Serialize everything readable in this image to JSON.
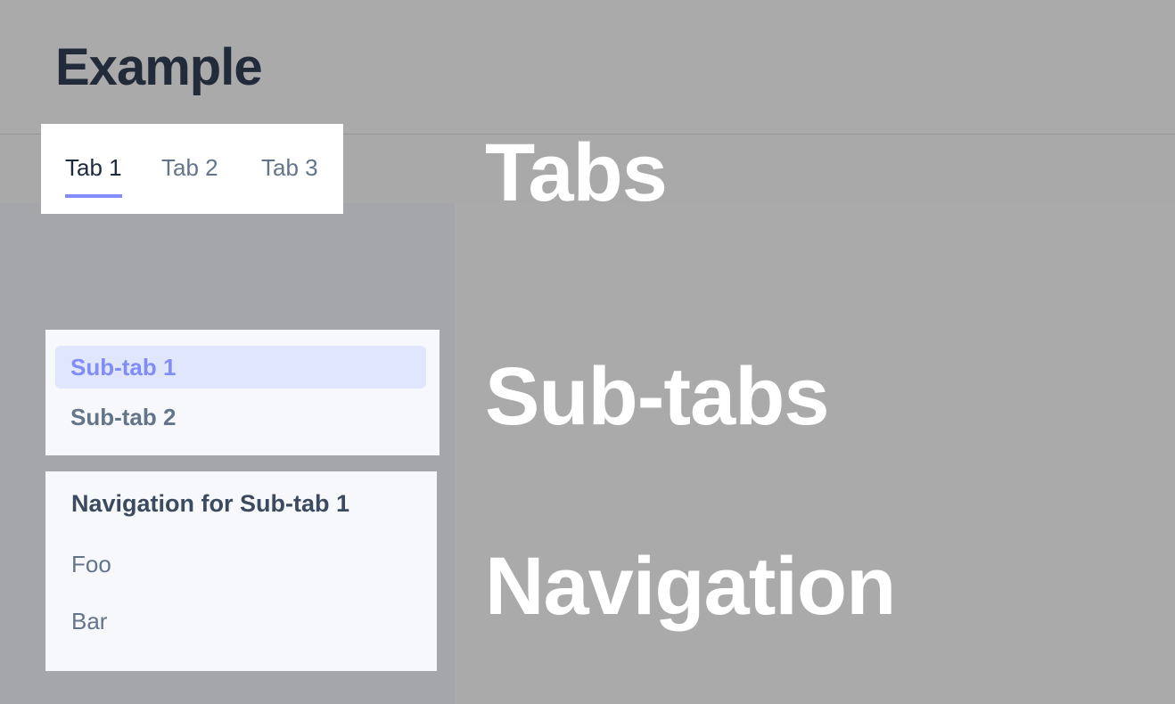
{
  "header": {
    "title": "Example"
  },
  "tabs": [
    {
      "label": "Tab 1",
      "active": true
    },
    {
      "label": "Tab 2",
      "active": false
    },
    {
      "label": "Tab 3",
      "active": false
    }
  ],
  "subtabs": [
    {
      "label": "Sub-tab 1",
      "active": true
    },
    {
      "label": "Sub-tab 2",
      "active": false
    }
  ],
  "navigation": {
    "heading": "Navigation for Sub-tab 1",
    "items": [
      {
        "label": "Foo"
      },
      {
        "label": "Bar"
      }
    ]
  },
  "annotations": {
    "tabs": "Tabs",
    "subtabs": "Sub-tabs",
    "navigation": "Navigation"
  },
  "colors": {
    "accent": "#818cf8",
    "active_subtab_bg": "#e0e7fd",
    "title": "#222b39",
    "muted_text": "#64748b"
  }
}
